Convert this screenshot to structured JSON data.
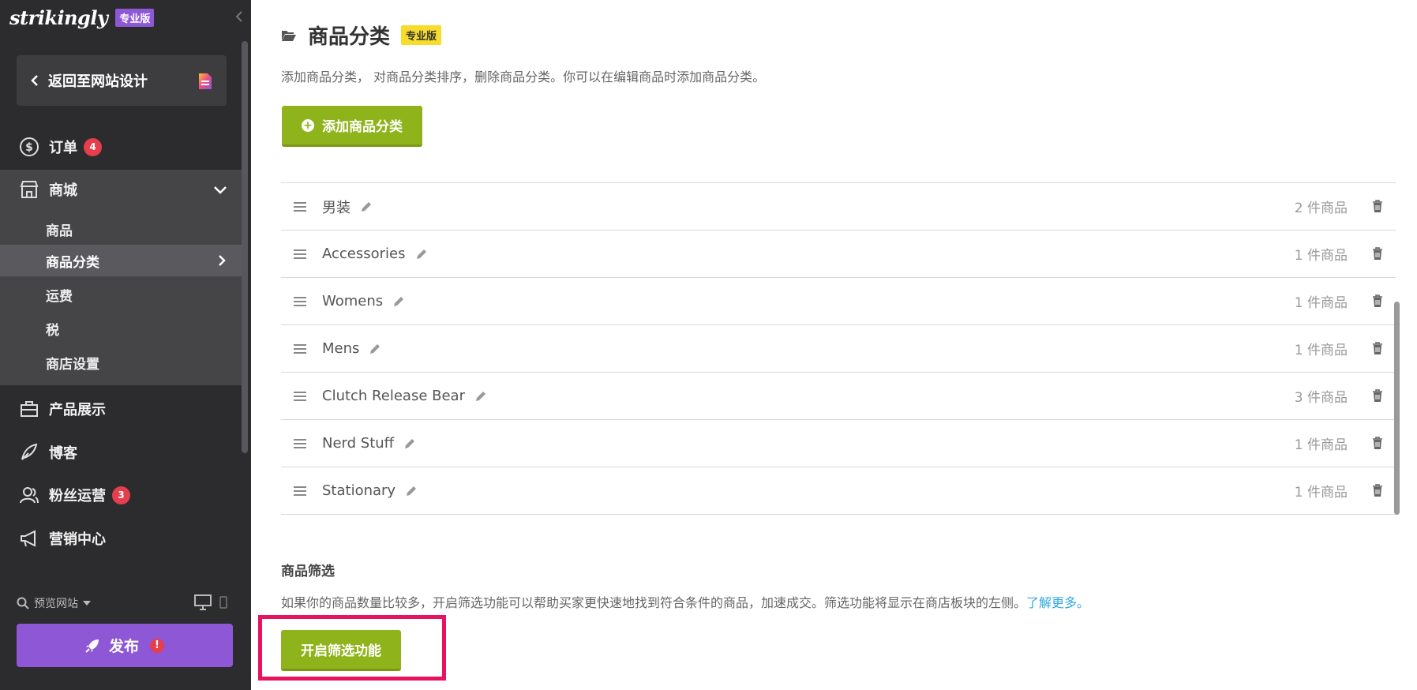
{
  "sidebar": {
    "logo": "strikingly",
    "plan_badge": "专业版",
    "back_label": "返回至网站设计",
    "orders": {
      "label": "订单",
      "count": "4"
    },
    "shop": {
      "label": "商城",
      "sub_items": [
        {
          "label": "商品"
        },
        {
          "label": "商品分类"
        },
        {
          "label": "运费"
        },
        {
          "label": "税"
        },
        {
          "label": "商店设置"
        }
      ]
    },
    "products_showcase": "产品展示",
    "blog": "博客",
    "fans": {
      "label": "粉丝运营",
      "count": "3"
    },
    "marketing": "营销中心",
    "preview_label": "预览网站",
    "publish_label": "发布",
    "publish_alert": "!"
  },
  "main": {
    "title": "商品分类",
    "pro_badge": "专业版",
    "description": "添加商品分类，  对商品分类排序，删除商品分类。你可以在编辑商品时添加商品分类。",
    "add_button": "添加商品分类",
    "categories": [
      {
        "name": "男装",
        "count": "2 件商品"
      },
      {
        "name": "Accessories",
        "count": "1 件商品"
      },
      {
        "name": "Womens",
        "count": "1 件商品"
      },
      {
        "name": "Mens",
        "count": "1 件商品"
      },
      {
        "name": "Clutch Release Bear",
        "count": "3 件商品"
      },
      {
        "name": "Nerd Stuff",
        "count": "1 件商品"
      },
      {
        "name": "Stationary",
        "count": "1 件商品"
      }
    ],
    "filter": {
      "title": "商品筛选",
      "description": "如果你的商品数量比较多，开启筛选功能可以帮助买家更快速地找到符合条件的商品，加速成交。筛选功能将显示在商店板块的左侧。",
      "learn_more": "了解更多。",
      "button": "开启筛选功能"
    }
  },
  "colors": {
    "sidebar_bg": "#2c2c2e",
    "purple_accent": "#8e57d6",
    "green_button": "#8fb31a",
    "pro_yellow": "#f7dc2c",
    "badge_red": "#e53e4d",
    "link_blue": "#2fa8dc",
    "highlight_pink": "#e8125f"
  }
}
